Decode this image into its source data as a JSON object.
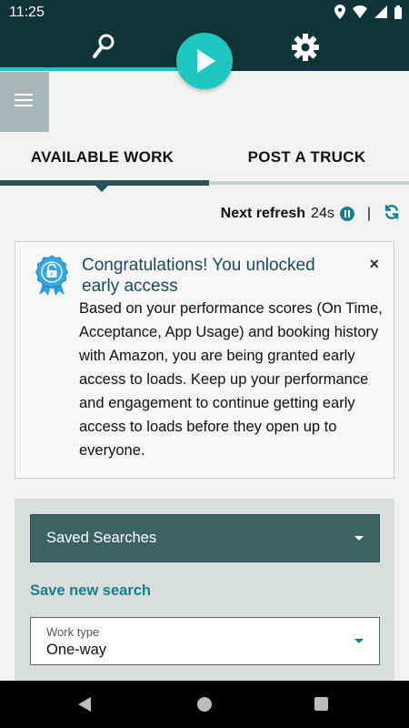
{
  "status_bar": {
    "time": "11:25",
    "icons": [
      "location-icon",
      "wifi-icon",
      "signal-icon",
      "battery-icon"
    ]
  },
  "top_nav": {
    "icons": [
      "search-icon",
      "play-icon",
      "gear-icon"
    ],
    "accent": "#1fc7c0",
    "background": "#10343a"
  },
  "tabs": [
    {
      "label": "AVAILABLE WORK",
      "active": true
    },
    {
      "label": "POST A TRUCK",
      "active": false
    }
  ],
  "refresh": {
    "label": "Next refresh",
    "countdown": "24s",
    "separator": "|"
  },
  "alert": {
    "title": "Congratulations! You unlocked early access",
    "close": "×",
    "body": "Based on your performance scores (On Time, Acceptance, App Usage) and booking history with Amazon, you are being granted early access to loads. Keep up your performance and engagement to continue getting early access to loads before they open up to everyone."
  },
  "search_panel": {
    "saved_searches_label": "Saved Searches",
    "save_new_search": "Save new search",
    "work_type_label": "Work type",
    "work_type_value": "One-way"
  },
  "colors": {
    "primary_dark": "#10343a",
    "accent": "#1fc7c0",
    "link": "#137f8f",
    "dropdown_bg": "#3c6262"
  }
}
